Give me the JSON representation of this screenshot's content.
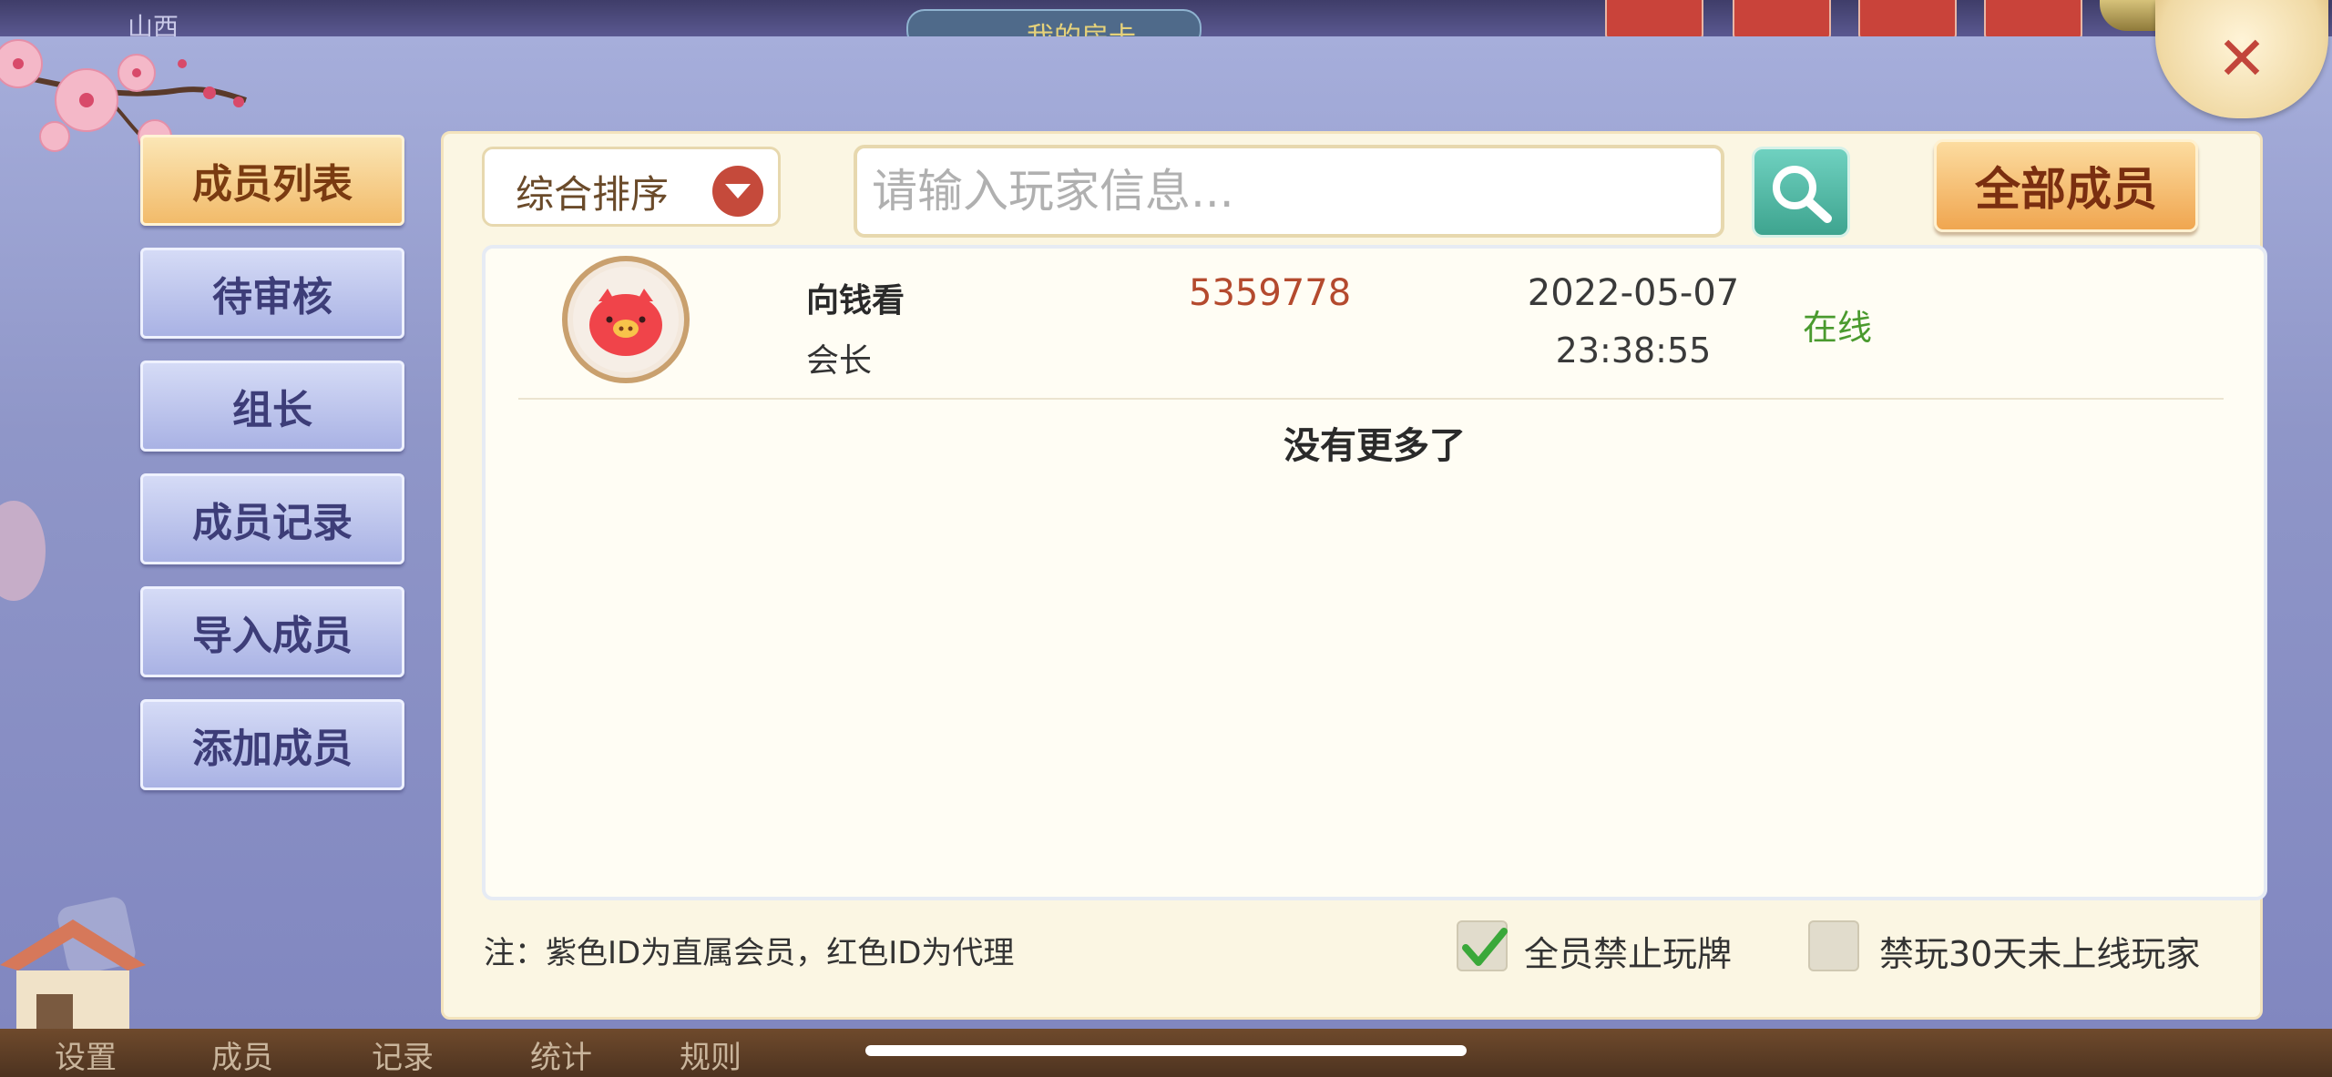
{
  "background": {
    "region_label": "山西",
    "room_card_label": "我的房卡"
  },
  "close": {
    "icon_label": "✕"
  },
  "sidebar": {
    "items": [
      {
        "label": "成员列表",
        "active": true
      },
      {
        "label": "待审核",
        "active": false
      },
      {
        "label": "组长",
        "active": false
      },
      {
        "label": "成员记录",
        "active": false
      },
      {
        "label": "导入成员",
        "active": false
      },
      {
        "label": "添加成员",
        "active": false
      }
    ]
  },
  "toolbar": {
    "sort_label": "综合排序",
    "search_placeholder": "请输入玩家信息...",
    "search_icon": "search-icon",
    "filter_button_label": "全部成员"
  },
  "members": [
    {
      "name": "向钱看",
      "role": "会长",
      "id": "5359778",
      "date": "2022-05-07",
      "time": "23:38:55",
      "status": "在线"
    }
  ],
  "list_footer": "没有更多了",
  "note": "注：紫色ID为直属会员，红色ID为代理",
  "options": {
    "ban_all_label": "全员禁止玩牌",
    "ban_all_checked": true,
    "ban_inactive_label": "禁玩30天未上线玩家",
    "ban_inactive_checked": false
  },
  "bottom_nav": {
    "tabs": [
      "设置",
      "成员",
      "记录",
      "统计",
      "规则"
    ]
  },
  "colors": {
    "accent_orange": "#f0a650",
    "id_red": "#b44a2e",
    "online_green": "#4a9a2e",
    "search_teal": "#3ea48f"
  }
}
